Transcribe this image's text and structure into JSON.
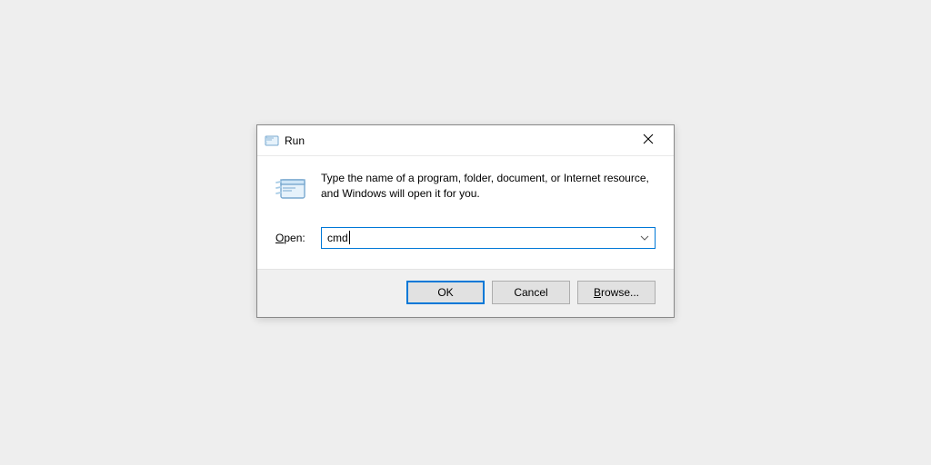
{
  "dialog": {
    "title": "Run",
    "description": "Type the name of a program, folder, document, or Internet resource, and Windows will open it for you.",
    "open_label_underlined": "O",
    "open_label_rest": "pen:",
    "open_value": "cmd",
    "buttons": {
      "ok_label": "OK",
      "cancel_label": "Cancel",
      "browse_underlined": "B",
      "browse_rest": "rowse..."
    }
  }
}
